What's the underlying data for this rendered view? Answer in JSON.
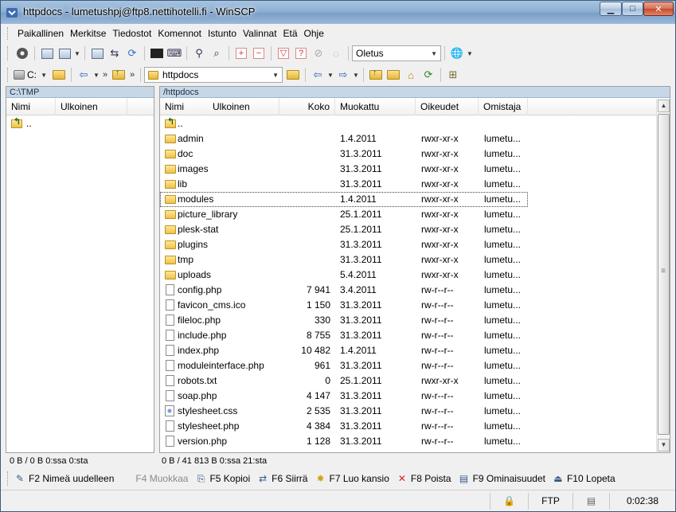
{
  "window": {
    "title": "httpdocs - lumetushpj@ftp8.nettihotelli.fi - WinSCP",
    "min_label": "▁",
    "max_label": "□",
    "close_label": "✕"
  },
  "menu": [
    "Paikallinen",
    "Merkitse",
    "Tiedostot",
    "Komennot",
    "Istunto",
    "Valinnat",
    "Etä",
    "Ohje"
  ],
  "toolbar": {
    "transfer_preset": "Oletus"
  },
  "local": {
    "drive": "C:",
    "path": "C:\\TMP",
    "columns": {
      "name": "Nimi",
      "ext": "Ulkoinen"
    },
    "rows": [
      {
        "name": "..",
        "type": "parent"
      }
    ],
    "status": "0 B / 0 B 0:ssa 0:sta"
  },
  "remote": {
    "dir": "httpdocs",
    "path": "/httpdocs",
    "columns": {
      "name": "Nimi",
      "ext": "Ulkoinen",
      "size": "Koko",
      "modified": "Muokattu",
      "rights": "Oikeudet",
      "owner": "Omistaja"
    },
    "rows": [
      {
        "type": "parent",
        "name": "..",
        "size": "",
        "modified": "",
        "rights": "",
        "owner": ""
      },
      {
        "type": "folder",
        "name": "admin",
        "size": "",
        "modified": "1.4.2011",
        "rights": "rwxr-xr-x",
        "owner": "lumetu..."
      },
      {
        "type": "folder",
        "name": "doc",
        "size": "",
        "modified": "31.3.2011",
        "rights": "rwxr-xr-x",
        "owner": "lumetu..."
      },
      {
        "type": "folder",
        "name": "images",
        "size": "",
        "modified": "31.3.2011",
        "rights": "rwxr-xr-x",
        "owner": "lumetu..."
      },
      {
        "type": "folder",
        "name": "lib",
        "size": "",
        "modified": "31.3.2011",
        "rights": "rwxr-xr-x",
        "owner": "lumetu..."
      },
      {
        "type": "folder",
        "name": "modules",
        "size": "",
        "modified": "1.4.2011",
        "rights": "rwxr-xr-x",
        "owner": "lumetu...",
        "focused": true
      },
      {
        "type": "folder",
        "name": "picture_library",
        "size": "",
        "modified": "25.1.2011",
        "rights": "rwxr-xr-x",
        "owner": "lumetu..."
      },
      {
        "type": "folder",
        "name": "plesk-stat",
        "size": "",
        "modified": "25.1.2011",
        "rights": "rwxr-xr-x",
        "owner": "lumetu..."
      },
      {
        "type": "folder",
        "name": "plugins",
        "size": "",
        "modified": "31.3.2011",
        "rights": "rwxr-xr-x",
        "owner": "lumetu..."
      },
      {
        "type": "folder",
        "name": "tmp",
        "size": "",
        "modified": "31.3.2011",
        "rights": "rwxr-xr-x",
        "owner": "lumetu..."
      },
      {
        "type": "folder",
        "name": "uploads",
        "size": "",
        "modified": "5.4.2011",
        "rights": "rwxr-xr-x",
        "owner": "lumetu..."
      },
      {
        "type": "file",
        "name": "config.php",
        "size": "7 941",
        "modified": "3.4.2011",
        "rights": "rw-r--r--",
        "owner": "lumetu..."
      },
      {
        "type": "file",
        "name": "favicon_cms.ico",
        "size": "1 150",
        "modified": "31.3.2011",
        "rights": "rw-r--r--",
        "owner": "lumetu..."
      },
      {
        "type": "file",
        "name": "fileloc.php",
        "size": "330",
        "modified": "31.3.2011",
        "rights": "rw-r--r--",
        "owner": "lumetu..."
      },
      {
        "type": "file",
        "name": "include.php",
        "size": "8 755",
        "modified": "31.3.2011",
        "rights": "rw-r--r--",
        "owner": "lumetu..."
      },
      {
        "type": "file",
        "name": "index.php",
        "size": "10 482",
        "modified": "1.4.2011",
        "rights": "rw-r--r--",
        "owner": "lumetu..."
      },
      {
        "type": "file",
        "name": "moduleinterface.php",
        "size": "961",
        "modified": "31.3.2011",
        "rights": "rw-r--r--",
        "owner": "lumetu..."
      },
      {
        "type": "file",
        "name": "robots.txt",
        "size": "0",
        "modified": "25.1.2011",
        "rights": "rwxr-xr-x",
        "owner": "lumetu..."
      },
      {
        "type": "file",
        "name": "soap.php",
        "size": "4 147",
        "modified": "31.3.2011",
        "rights": "rw-r--r--",
        "owner": "lumetu..."
      },
      {
        "type": "css",
        "name": "stylesheet.css",
        "size": "2 535",
        "modified": "31.3.2011",
        "rights": "rw-r--r--",
        "owner": "lumetu..."
      },
      {
        "type": "file",
        "name": "stylesheet.php",
        "size": "4 384",
        "modified": "31.3.2011",
        "rights": "rw-r--r--",
        "owner": "lumetu..."
      },
      {
        "type": "file",
        "name": "version.php",
        "size": "1 128",
        "modified": "31.3.2011",
        "rights": "rw-r--r--",
        "owner": "lumetu..."
      }
    ],
    "status": "0 B / 41 813 B 0:ssa 21:sta"
  },
  "fkeys": [
    {
      "label": "F2 Nimeä uudelleen",
      "icon": "rename-icon",
      "glyph": "✎",
      "enabled": true
    },
    {
      "label": "F4 Muokkaa",
      "icon": "edit-icon",
      "glyph": "",
      "enabled": false
    },
    {
      "label": "F5 Kopioi",
      "icon": "copy-icon",
      "glyph": "⎘",
      "enabled": true
    },
    {
      "label": "F6 Siirrä",
      "icon": "move-icon",
      "glyph": "⇄",
      "enabled": true
    },
    {
      "label": "F7 Luo kansio",
      "icon": "new-folder-icon",
      "glyph": "✸",
      "enabled": true
    },
    {
      "label": "F8 Poista",
      "icon": "delete-icon",
      "glyph": "✕",
      "enabled": true
    },
    {
      "label": "F9 Ominaisuudet",
      "icon": "properties-icon",
      "glyph": "▤",
      "enabled": true
    },
    {
      "label": "F10 Lopeta",
      "icon": "quit-icon",
      "glyph": "⏏",
      "enabled": true
    }
  ],
  "statusbar": {
    "protocol": "FTP",
    "elapsed": "0:02:38"
  },
  "colors": {
    "title_bar": "#8fb0d3",
    "path_bar": "#c6d8e8",
    "folder": "#eec14a",
    "delete_red": "#d22"
  }
}
